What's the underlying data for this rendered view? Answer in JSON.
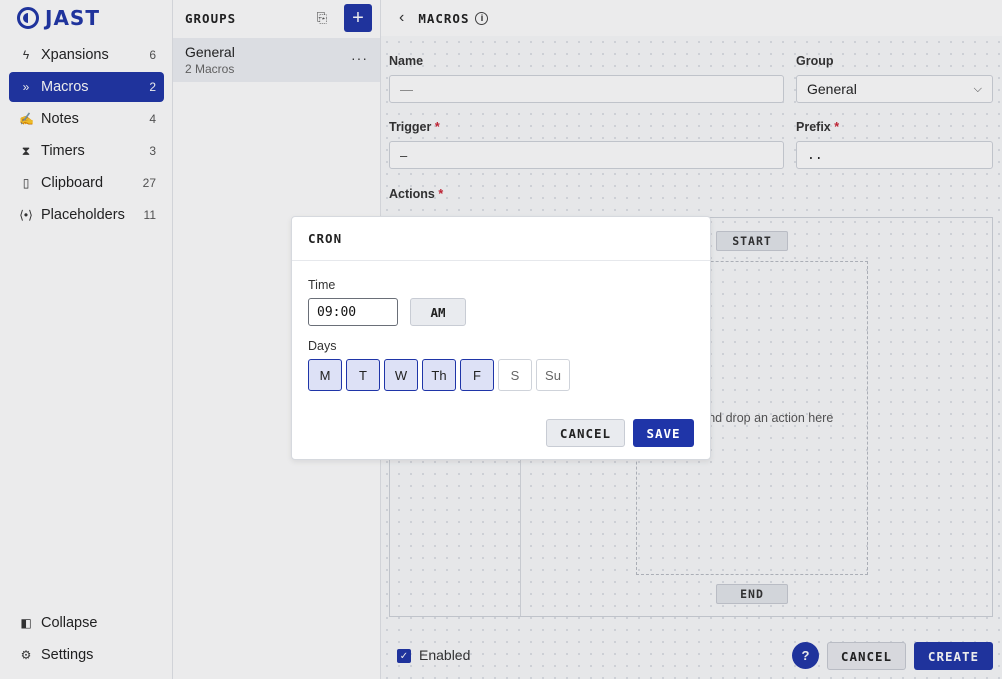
{
  "app": {
    "logo_text": "JAST",
    "accent_color": "#1f35a8"
  },
  "sidebar": {
    "items": [
      {
        "label": "Xpansions",
        "count": "6",
        "icon": "lightning-icon"
      },
      {
        "label": "Macros",
        "count": "2",
        "icon": "chevrons-right-icon",
        "active": true
      },
      {
        "label": "Notes",
        "count": "4",
        "icon": "signature-icon"
      },
      {
        "label": "Timers",
        "count": "3",
        "icon": "hourglass-icon"
      },
      {
        "label": "Clipboard",
        "count": "27",
        "icon": "clipboard-icon"
      },
      {
        "label": "Placeholders",
        "count": "11",
        "icon": "brackets-icon"
      }
    ],
    "bottom": [
      {
        "label": "Collapse",
        "icon": "collapse-icon"
      },
      {
        "label": "Settings",
        "icon": "gear-icon"
      }
    ]
  },
  "groups": {
    "title": "GROUPS",
    "items": [
      {
        "name": "General",
        "count": "2 Macros"
      }
    ]
  },
  "main": {
    "title": "MACROS",
    "name_label": "Name",
    "name_value": "—",
    "group_label": "Group",
    "group_value": "General",
    "trigger_label": "Trigger",
    "trigger_value": "–",
    "prefix_label": "Prefix",
    "prefix_value": "..",
    "actions_label": "Actions",
    "required_mark": "*",
    "start_label": "START",
    "end_label": "END",
    "drop_text": "Drag and drop an action here",
    "enabled_label": "Enabled",
    "enabled_checked": true,
    "help_label": "?",
    "cancel_label": "CANCEL",
    "create_label": "CREATE"
  },
  "modal": {
    "title": "CRON",
    "time_label": "Time",
    "time_value": "09:00",
    "ampm": "AM",
    "days_label": "Days",
    "days": [
      {
        "label": "M",
        "selected": true
      },
      {
        "label": "T",
        "selected": true
      },
      {
        "label": "W",
        "selected": true
      },
      {
        "label": "Th",
        "selected": true
      },
      {
        "label": "F",
        "selected": true
      },
      {
        "label": "S",
        "selected": false
      },
      {
        "label": "Su",
        "selected": false
      }
    ],
    "cancel_label": "CANCEL",
    "save_label": "SAVE"
  }
}
